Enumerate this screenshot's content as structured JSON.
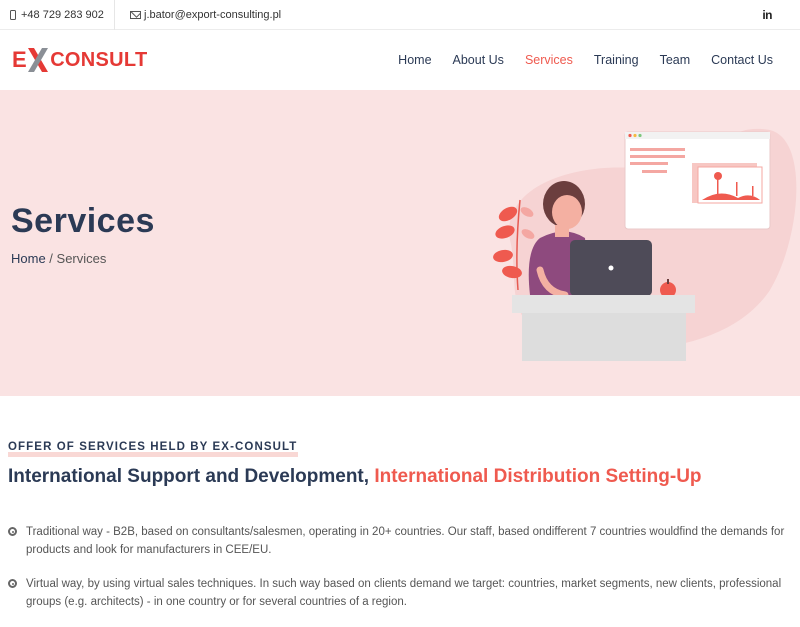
{
  "topbar": {
    "phone": "+48 729 283 902",
    "email": "j.bator@export-consulting.pl",
    "linkedin": "in"
  },
  "logo": {
    "left": "E",
    "mid": "X",
    "right": "CONSULT"
  },
  "nav": {
    "items": [
      {
        "label": "Home"
      },
      {
        "label": "About Us"
      },
      {
        "label": "Services",
        "active": true
      },
      {
        "label": "Training"
      },
      {
        "label": "Team"
      },
      {
        "label": "Contact Us"
      }
    ]
  },
  "hero": {
    "title": "Services",
    "breadcrumb_home": "Home",
    "breadcrumb_sep": " / ",
    "breadcrumb_current": "Services"
  },
  "content": {
    "kicker": "OFFER OF SERVICES HELD BY EX-CONSULT",
    "headline_main": "International Support and Development, ",
    "headline_accent": "International Distribution Setting-Up",
    "bullets": [
      "Traditional way - B2B, based on consultants/salesmen, operating in 20+ countries. Our staff, based ondifferent 7 countries wouldfind the demands for products and look for manufacturers in CEE/EU.",
      "Virtual way, by using virtual sales techniques. In such way based on clients demand we target: countries, market segments, new clients, professional groups (e.g. architects) - in one country or for several countries of a region."
    ]
  },
  "colors": {
    "accent": "#ef5a4f",
    "navy": "#2b3a55",
    "hero_bg": "#fae3e3"
  }
}
